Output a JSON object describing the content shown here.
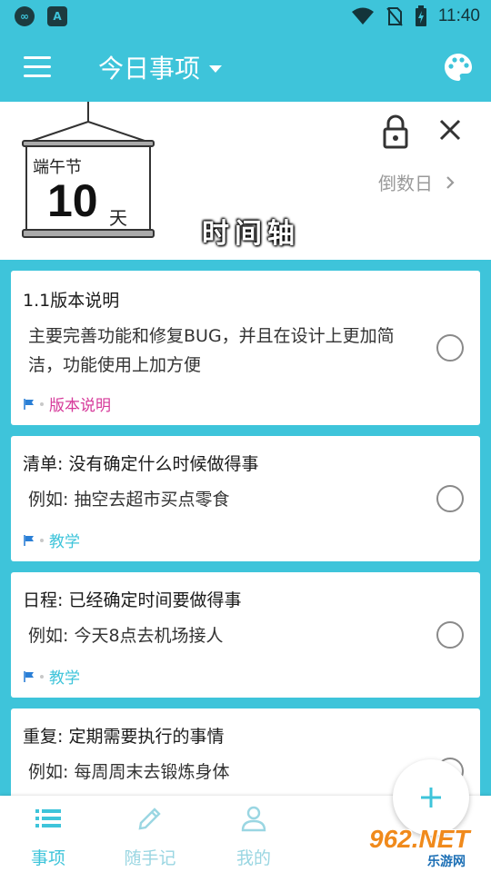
{
  "status_bar": {
    "time": "11:40",
    "left_icons": [
      "cast-icon",
      "text-app-icon"
    ]
  },
  "app_bar": {
    "title": "今日事项"
  },
  "countdown": {
    "festival": "端午节",
    "days": "10",
    "unit": "天",
    "link_label": "倒数日",
    "timeline_label": "时间轴"
  },
  "tasks": [
    {
      "title": "1.1版本说明",
      "desc": "主要完善功能和修复BUG，并且在设计上更加简洁，功能使用上加方便",
      "tag": "版本说明",
      "tag_color": "#d6399a"
    },
    {
      "title": "清单: 没有确定什么时候做得事",
      "desc": "例如: 抽空去超市买点零食",
      "tag": "教学",
      "tag_color": "#3ec4da"
    },
    {
      "title": "日程: 已经确定时间要做得事",
      "desc": "例如: 今天8点去机场接人",
      "tag": "教学",
      "tag_color": "#3ec4da"
    },
    {
      "title": "重复: 定期需要执行的事情",
      "desc": "例如: 每周周末去锻炼身体",
      "tag": "",
      "tag_color": "#3ec4da"
    }
  ],
  "bottom_nav": [
    {
      "label": "事项",
      "icon": "list-icon",
      "active": true
    },
    {
      "label": "随手记",
      "icon": "pencil-icon",
      "active": false
    },
    {
      "label": "我的",
      "icon": "person-icon",
      "active": false
    }
  ],
  "colors": {
    "accent": "#3ec4da",
    "inactive": "#9ad6e2"
  },
  "watermark": {
    "big": "962.NET",
    "small": "乐游网"
  }
}
